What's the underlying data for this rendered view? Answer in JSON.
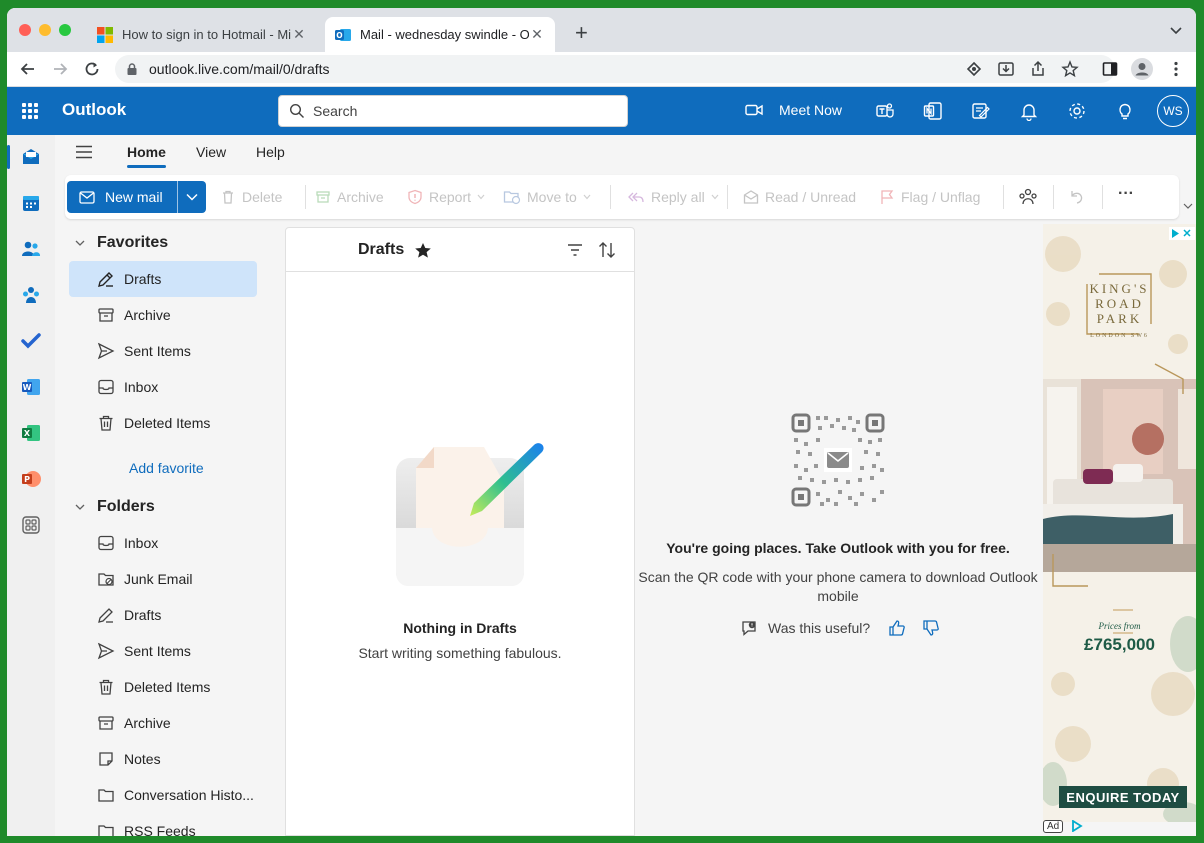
{
  "browser": {
    "tabs": [
      {
        "title": "How to sign in to Hotmail - Microsoft Support",
        "close": "✕"
      },
      {
        "title": "Mail - wednesday swindle - Outlook",
        "close": "✕"
      }
    ],
    "new_tab": "+",
    "url": "outlook.live.com/mail/0/drafts"
  },
  "header": {
    "brand": "Outlook",
    "search_placeholder": "Search",
    "meet_now": "Meet Now",
    "avatar_initials": "WS",
    "color": "#0f6cbd"
  },
  "ribbon": {
    "tabs": [
      "Home",
      "View",
      "Help"
    ],
    "new_mail": "New mail",
    "actions": [
      "Delete",
      "Archive",
      "Report",
      "Move to",
      "Reply all",
      "Read / Unread",
      "Flag / Unflag"
    ],
    "more": "···"
  },
  "folders": {
    "favorites_header": "Favorites",
    "favorites": [
      "Drafts",
      "Archive",
      "Sent Items",
      "Inbox",
      "Deleted Items"
    ],
    "add_favorite": "Add favorite",
    "folders_header": "Folders",
    "items": [
      "Inbox",
      "Junk Email",
      "Drafts",
      "Sent Items",
      "Deleted Items",
      "Archive",
      "Notes",
      "Conversation Histo...",
      "RSS Feeds"
    ]
  },
  "message_list": {
    "title": "Drafts",
    "empty_title": "Nothing in Drafts",
    "empty_subtitle": "Start writing something fabulous."
  },
  "reading_pane": {
    "title": "You're going places. Take Outlook with you for free.",
    "subtitle": "Scan the QR code with your phone camera to download Outlook mobile",
    "useful": "Was this useful?"
  },
  "ad": {
    "brand_line1": "KING'S",
    "brand_line2": "ROAD",
    "brand_line3": "PARK",
    "brand_sub": "LONDON SW6",
    "prices_from": "Prices from",
    "price": "£765,000",
    "cta": "ENQUIRE TODAY",
    "ad_label": "Ad"
  }
}
